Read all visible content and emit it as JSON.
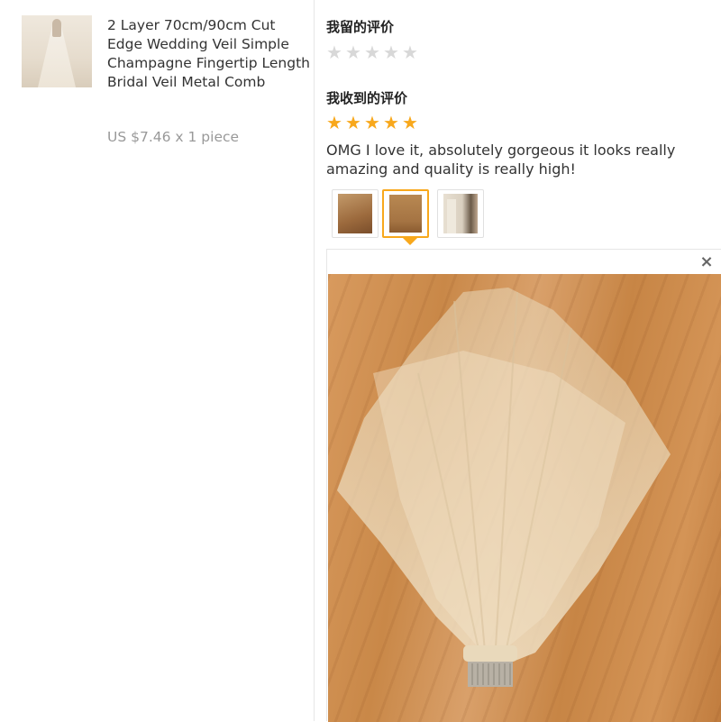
{
  "product": {
    "title": "2 Layer 70cm/90cm Cut Edge Wedding Veil Simple Champagne Fingertip Length Bridal Veil Metal Comb",
    "price": "US $7.46 x 1 piece"
  },
  "my_review": {
    "heading": "我留的评价",
    "rating": 0,
    "max_rating": 5
  },
  "received_review": {
    "heading": "我收到的评价",
    "rating": 5,
    "max_rating": 5,
    "text": "OMG I love it, absolutely gorgeous it looks really amazing and quality is really high!",
    "photos": [
      {
        "name": "review-photo-1",
        "active": false
      },
      {
        "name": "review-photo-2",
        "active": true
      },
      {
        "name": "review-photo-3",
        "active": false
      }
    ]
  },
  "viewer": {
    "close_icon": "×"
  },
  "colors": {
    "star_full": "#f8a81c",
    "star_empty": "#d8d8d8",
    "price": "#999999"
  },
  "icons": {
    "star": "★",
    "close": "close-icon"
  }
}
